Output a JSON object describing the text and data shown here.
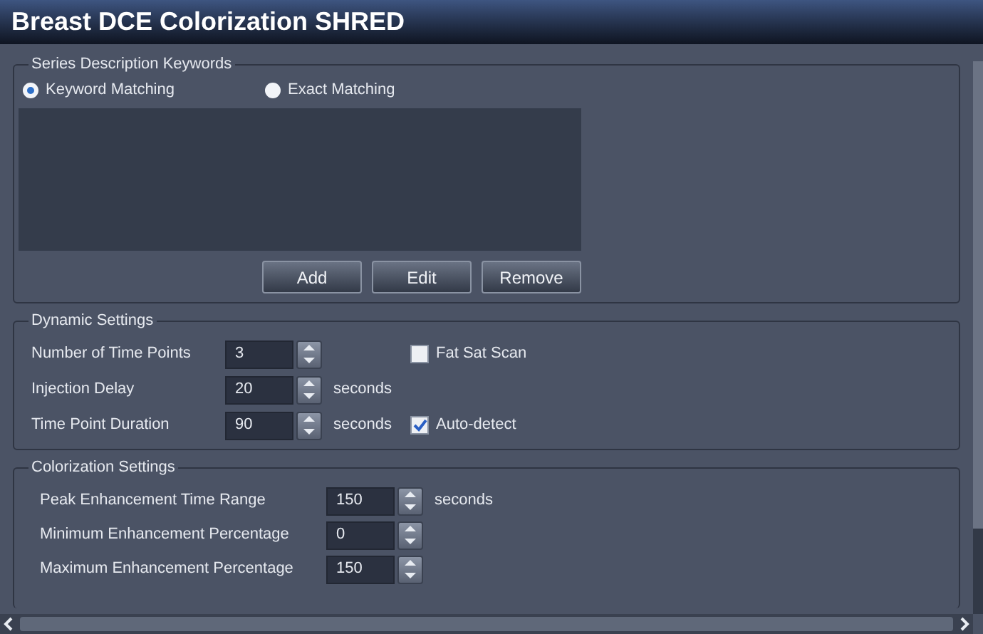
{
  "window": {
    "title": "Breast DCE Colorization SHRED"
  },
  "series_keywords": {
    "title": "Series Description Keywords",
    "radios": [
      {
        "label": "Keyword Matching",
        "selected": true
      },
      {
        "label": "Exact Matching",
        "selected": false
      }
    ],
    "buttons": [
      "Add",
      "Edit",
      "Remove"
    ]
  },
  "dynamic_settings": {
    "title": "Dynamic Settings",
    "rows": [
      {
        "label": "Number of Time Points",
        "value": "3",
        "checkbox": {
          "label": "Fat Sat Scan",
          "checked": false
        }
      },
      {
        "label": "Injection Delay",
        "value": "20",
        "unit": "seconds"
      },
      {
        "label": "Time Point Duration",
        "value": "90",
        "unit": "seconds",
        "checkbox": {
          "label": "Auto-detect",
          "checked": true
        }
      }
    ]
  },
  "colorization_settings": {
    "title": "Colorization Settings",
    "rows": [
      {
        "label": "Peak Enhancement Time Range",
        "value": "150",
        "unit": "seconds"
      },
      {
        "label": "Minimum Enhancement Percentage",
        "value": "0"
      },
      {
        "label": "Maximum Enhancement Percentage",
        "value": "150"
      }
    ]
  }
}
